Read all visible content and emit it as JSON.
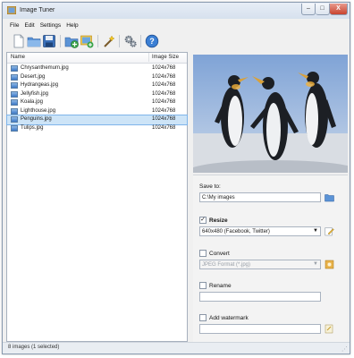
{
  "window": {
    "title": "Image Tuner"
  },
  "title_buttons": {
    "minimize": "–",
    "maximize": "□",
    "close": "X"
  },
  "menu": [
    "File",
    "Edit",
    "Settings",
    "Help"
  ],
  "toolbar_icons": [
    "new-file-icon",
    "open-folder-icon",
    "save-icon",
    "add-images-icon",
    "add-folder-icon",
    "magic-wand-icon",
    "gears-icon",
    "help-icon"
  ],
  "file_list": {
    "columns": {
      "name": "Name",
      "size": "Image Size"
    },
    "rows": [
      {
        "name": "Chrysanthemum.jpg",
        "size": "1024x768"
      },
      {
        "name": "Desert.jpg",
        "size": "1024x768"
      },
      {
        "name": "Hydrangeas.jpg",
        "size": "1024x768"
      },
      {
        "name": "Jellyfish.jpg",
        "size": "1024x768"
      },
      {
        "name": "Koala.jpg",
        "size": "1024x768"
      },
      {
        "name": "Lighthouse.jpg",
        "size": "1024x768"
      },
      {
        "name": "Penguins.jpg",
        "size": "1024x768",
        "selected": true
      },
      {
        "name": "Tulips.jpg",
        "size": "1024x768"
      }
    ]
  },
  "options": {
    "save_to_label": "Save to:",
    "save_to_path": "C:\\My images",
    "resize": {
      "label": "Resize",
      "checked": true,
      "value": "640x480 (Facebook, Twitter)"
    },
    "convert": {
      "label": "Convert",
      "checked": false,
      "value": "JPEG Format (*.jpg)"
    },
    "rename": {
      "label": "Rename",
      "checked": false,
      "value": ""
    },
    "watermark": {
      "label": "Add watermark",
      "checked": false,
      "value": ""
    }
  },
  "status": {
    "text": "8 images (1 selected)"
  },
  "colors": {
    "selection": "#cde4f7",
    "accent": "#3c78c6"
  }
}
